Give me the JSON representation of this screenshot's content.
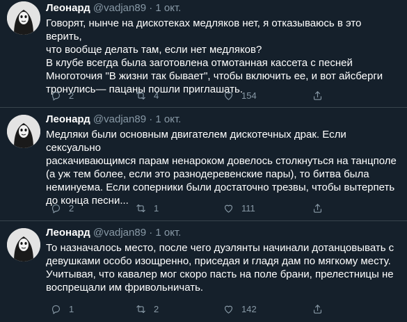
{
  "tweets": [
    {
      "author": "Леонард",
      "handle": "@vadjan89",
      "separator": "·",
      "time": "1 окт.",
      "text": [
        "Говорят, нынче на дискотеках медляков нет, я отказываюсь в это верить,",
        "что вообще делать там, если нет медляков?",
        "В клубе всегда была заготовлена отмотанная кассета с песней",
        "Многоточия \"В жизни так бывает\", чтобы включить ее, и вот айсберги",
        "тронулись— пацаны пошли приглашать."
      ],
      "replies": "2",
      "retweets": "4",
      "likes": "154"
    },
    {
      "author": "Леонард",
      "handle": "@vadjan89",
      "separator": "·",
      "time": "1 окт.",
      "text": [
        "Медляки были основным двигателем дискотечных драк. Если сексуально",
        "раскачивающимся парам ненароком довелось столкнуться на танцполе",
        "(а уж тем более, если это разнодеревенские пары), то битва была",
        "неминуема. Если соперники были достаточно трезвы, чтобы вытерпеть",
        "до конца песни..."
      ],
      "replies": "2",
      "retweets": "1",
      "likes": "111"
    },
    {
      "author": "Леонард",
      "handle": "@vadjan89",
      "separator": "·",
      "time": "1 окт.",
      "text": [
        "То назначалось место, после чего дуэлянты начинали дотанцовывать с",
        "девушками особо изощренно, приседая и гладя дам по мягкому месту.",
        "Учитывая, что кавалер мог скоро пасть на поле брани, прелестницы не",
        "воспрещали им фривольничать."
      ],
      "replies": "1",
      "retweets": "2",
      "likes": "142"
    }
  ],
  "icons": {
    "reply": "reply-icon",
    "retweet": "retweet-icon",
    "like": "heart-icon",
    "share": "share-icon"
  },
  "colors": {
    "background": "#15202b",
    "text": "#ffffff",
    "secondary": "#8899a6",
    "divider": "#38444d"
  }
}
